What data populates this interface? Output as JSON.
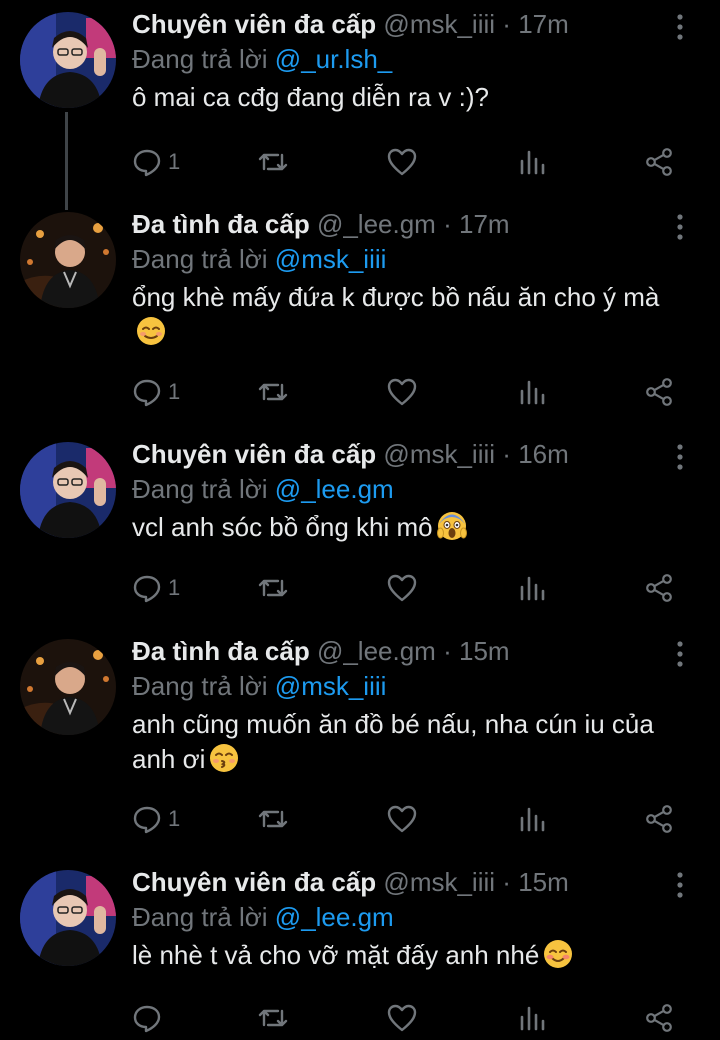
{
  "tweets": [
    {
      "author": {
        "name": "Chuyên viên đa cấp",
        "handle": "@msk_iiii"
      },
      "separator": "·",
      "time": "17m",
      "reply_prefix": "Đang trả lời",
      "reply_to": "@_ur.lsh_",
      "text": "ô mai ca cđg đang diễn ra v :)?",
      "emoji": "",
      "reply_count": "1"
    },
    {
      "author": {
        "name": "Đa tình đa cấp",
        "handle": "@_lee.gm"
      },
      "separator": "·",
      "time": "17m",
      "reply_prefix": "Đang trả lời",
      "reply_to": "@msk_iiii",
      "text": "ổng khè mấy đứa k được bồ nấu ăn cho ý mà",
      "emoji": "relieved-face",
      "reply_count": "1"
    },
    {
      "author": {
        "name": "Chuyên viên đa cấp",
        "handle": "@msk_iiii"
      },
      "separator": "·",
      "time": "16m",
      "reply_prefix": "Đang trả lời",
      "reply_to": "@_lee.gm",
      "text": "vcl anh sóc bồ ổng khi mô",
      "emoji": "screaming-face",
      "reply_count": "1"
    },
    {
      "author": {
        "name": "Đa tình đa cấp",
        "handle": "@_lee.gm"
      },
      "separator": "·",
      "time": "15m",
      "reply_prefix": "Đang trả lời",
      "reply_to": "@msk_iiii",
      "text": "anh cũng muốn ăn đồ bé nấu, nha cún iu của anh ơi",
      "emoji": "kissing-face",
      "reply_count": "1"
    },
    {
      "author": {
        "name": "Chuyên viên đa cấp",
        "handle": "@msk_iiii"
      },
      "separator": "·",
      "time": "15m",
      "reply_prefix": "Đang trả lời",
      "reply_to": "@_lee.gm",
      "text": "lè nhè t vả cho vỡ mặt đấy anh nhé",
      "emoji": "smiling-face-blushing",
      "reply_count": ""
    }
  ],
  "icons": {
    "reply": "reply-icon",
    "retweet": "retweet-icon",
    "like": "like-icon",
    "views": "views-icon",
    "share": "share-icon",
    "more": "more-icon"
  },
  "colors": {
    "background": "#000000",
    "primary_text": "#e7e9ea",
    "secondary_text": "#71767b",
    "mention": "#1d9bf0",
    "thread_line": "#3f4448"
  }
}
